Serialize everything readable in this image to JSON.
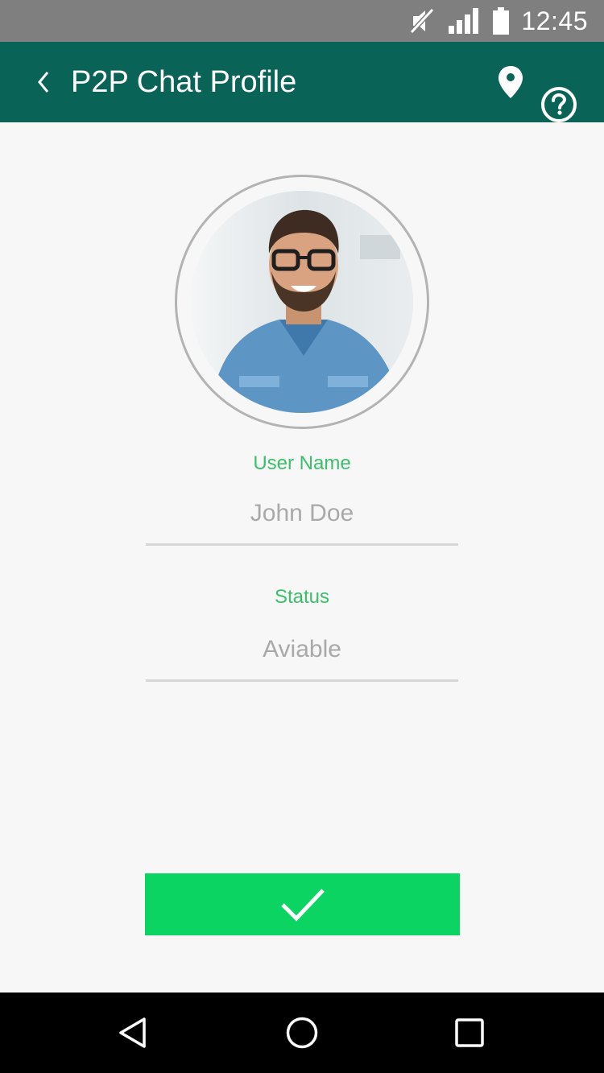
{
  "status_bar": {
    "time": "12:45",
    "icons": [
      "mute-icon",
      "signal-icon",
      "battery-icon"
    ]
  },
  "app_bar": {
    "title": "P2P Chat Profile",
    "icons": [
      "back-icon",
      "location-pin-icon",
      "help-icon"
    ]
  },
  "profile": {
    "username_label": "User Name",
    "username_value": "John Doe",
    "status_label": "Status",
    "status_value": "Aviable"
  },
  "actions": {
    "confirm_icon": "checkmark-icon"
  },
  "nav": {
    "icons": [
      "back-triangle-icon",
      "home-circle-icon",
      "recents-square-icon"
    ]
  },
  "colors": {
    "status_bar": "#7f7f7f",
    "app_bar": "#096357",
    "accent_label": "#3bbf6a",
    "confirm_button": "#0cd462",
    "background": "#f7f7f7"
  }
}
